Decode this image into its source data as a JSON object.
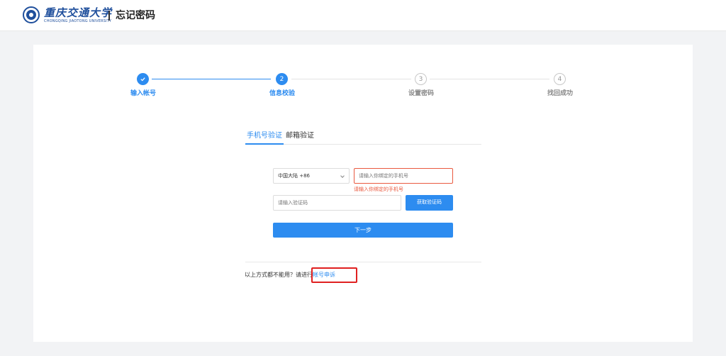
{
  "header": {
    "logo_cn": "重庆交通大学",
    "logo_en": "CHONGQING JIAOTONG UNIVERSITY",
    "page_title": "忘记密码"
  },
  "steps": [
    {
      "number": "1",
      "label": "输入帐号",
      "state": "done",
      "icon": "check-icon"
    },
    {
      "number": "2",
      "label": "信息校验",
      "state": "active"
    },
    {
      "number": "3",
      "label": "设置密码",
      "state": "pending"
    },
    {
      "number": "4",
      "label": "找回成功",
      "state": "pending"
    }
  ],
  "tabs": [
    {
      "label": "手机号验证",
      "active": true
    },
    {
      "label": "邮箱验证",
      "active": false
    }
  ],
  "form": {
    "region_select": {
      "value": "中国大陆 +86"
    },
    "phone": {
      "placeholder": "请输入你绑定的手机号"
    },
    "phone_error": "请输入你绑定的手机号",
    "code": {
      "placeholder": "请输入验证码"
    },
    "get_code_label": "获取验证码",
    "next_label": "下一步"
  },
  "footer": {
    "prefix": "以上方式都不能用？请进行",
    "link": "帐号申诉"
  },
  "colors": {
    "primary": "#2d8cf0",
    "error": "#e9593f",
    "brand": "#1f4f9c",
    "highlight": "#e02020"
  }
}
